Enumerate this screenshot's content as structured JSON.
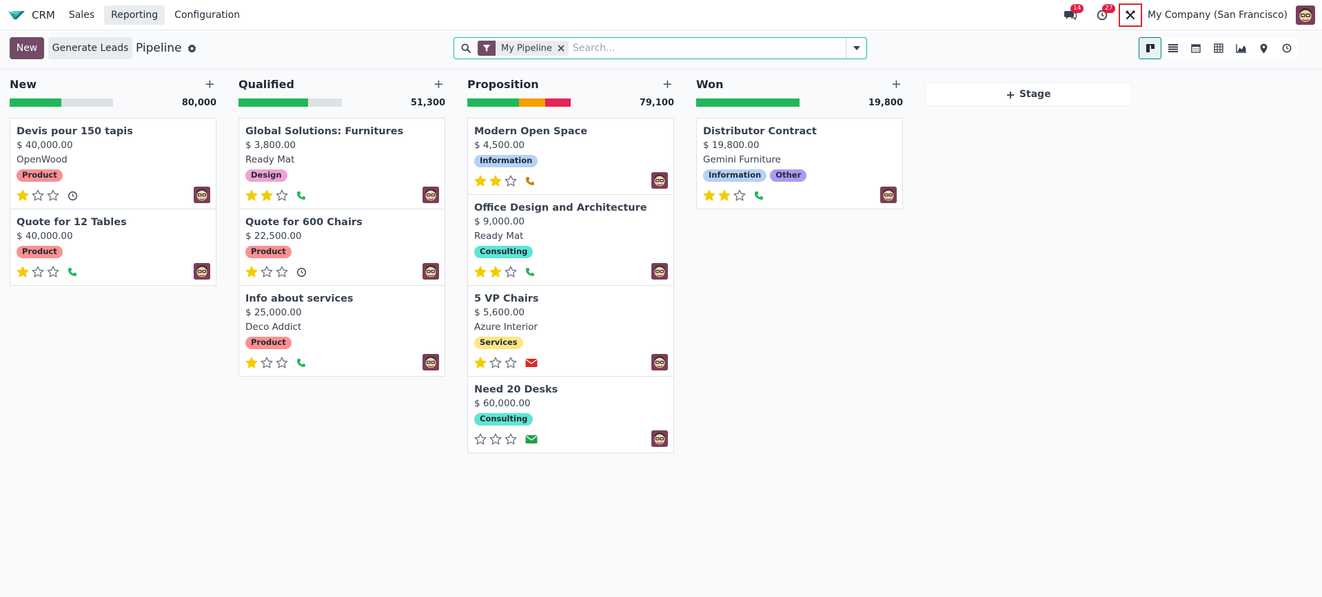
{
  "app": {
    "name": "CRM",
    "menu": [
      {
        "label": "Sales"
      },
      {
        "label": "Reporting"
      },
      {
        "label": "Configuration"
      }
    ],
    "messages_count": "14",
    "activities_count": "27",
    "company": "My Company (San Francisco)"
  },
  "control": {
    "new_label": "New",
    "generate_label": "Generate Leads",
    "title": "Pipeline",
    "facet_label": "My Pipeline",
    "search_placeholder": "Search..."
  },
  "colors": {
    "primary": "#714b67",
    "teal": "#017e84",
    "won": "#21b75a",
    "planned": "#f59f00",
    "overdue": "#e6245b",
    "star_filled": "#f3cc00",
    "badge": "#e11d48"
  },
  "stage_button": "Stage",
  "columns": [
    {
      "title": "New",
      "total": "80,000",
      "progress": [
        {
          "fraction": 0.5,
          "color": "#21b75a"
        },
        {
          "fraction": 0.5,
          "color": "#dee2e6"
        }
      ],
      "cards": [
        {
          "title": "Devis pour 150 tapis",
          "amount": "$ 40,000.00",
          "customer": "OpenWood",
          "tags": [
            {
              "label": "Product",
              "color": "#fc9090"
            }
          ],
          "stars": 1,
          "activity": "clock-icon"
        },
        {
          "title": "Quote for 12 Tables",
          "amount": "$ 40,000.00",
          "customer": "",
          "tags": [
            {
              "label": "Product",
              "color": "#fc9090"
            }
          ],
          "stars": 1,
          "activity": "phone-icon"
        }
      ]
    },
    {
      "title": "Qualified",
      "total": "51,300",
      "progress": [
        {
          "fraction": 0.67,
          "color": "#21b75a"
        },
        {
          "fraction": 0.33,
          "color": "#dee2e6"
        }
      ],
      "cards": [
        {
          "title": "Global Solutions: Furnitures",
          "amount": "$ 3,800.00",
          "customer": "Ready Mat",
          "tags": [
            {
              "label": "Design",
              "color": "#f0a2d3"
            }
          ],
          "stars": 2,
          "activity": "phone-icon"
        },
        {
          "title": "Quote for 600 Chairs",
          "amount": "$ 22,500.00",
          "customer": "",
          "tags": [
            {
              "label": "Product",
              "color": "#fc9090"
            }
          ],
          "stars": 1,
          "activity": "clock-icon"
        },
        {
          "title": "Info about services",
          "amount": "$ 25,000.00",
          "customer": "Deco Addict",
          "tags": [
            {
              "label": "Product",
              "color": "#fc9090"
            }
          ],
          "stars": 1,
          "activity": "phone-icon"
        }
      ]
    },
    {
      "title": "Proposition",
      "total": "79,100",
      "progress": [
        {
          "fraction": 0.5,
          "color": "#21b75a"
        },
        {
          "fraction": 0.25,
          "color": "#f59f00"
        },
        {
          "fraction": 0.25,
          "color": "#e6245b"
        }
      ],
      "cards": [
        {
          "title": "Modern Open Space",
          "amount": "$ 4,500.00",
          "customer": "",
          "tags": [
            {
              "label": "Information",
              "color": "#b5d2f7"
            }
          ],
          "stars": 2,
          "activity": "phone-icon-orange"
        },
        {
          "title": "Office Design and Architecture",
          "amount": "$ 9,000.00",
          "customer": "Ready Mat",
          "tags": [
            {
              "label": "Consulting",
              "color": "#5ee6d3"
            }
          ],
          "stars": 2,
          "activity": "phone-icon"
        },
        {
          "title": "5 VP Chairs",
          "amount": "$ 5,600.00",
          "customer": "Azure Interior",
          "tags": [
            {
              "label": "Services",
              "color": "#fce784"
            }
          ],
          "stars": 1,
          "activity": "envelope-icon-red"
        },
        {
          "title": "Need 20 Desks",
          "amount": "$ 60,000.00",
          "customer": "",
          "tags": [
            {
              "label": "Consulting",
              "color": "#5ee6d3"
            }
          ],
          "stars": 0,
          "activity": "envelope-icon-green"
        }
      ]
    },
    {
      "title": "Won",
      "total": "19,800",
      "progress": [
        {
          "fraction": 1.0,
          "color": "#21b75a"
        }
      ],
      "cards": [
        {
          "title": "Distributor Contract",
          "amount": "$ 19,800.00",
          "customer": "Gemini Furniture",
          "tags": [
            {
              "label": "Information",
              "color": "#b5d2f7"
            },
            {
              "label": "Other",
              "color": "#a99bf2"
            }
          ],
          "stars": 2,
          "activity": "phone-icon"
        }
      ]
    }
  ]
}
